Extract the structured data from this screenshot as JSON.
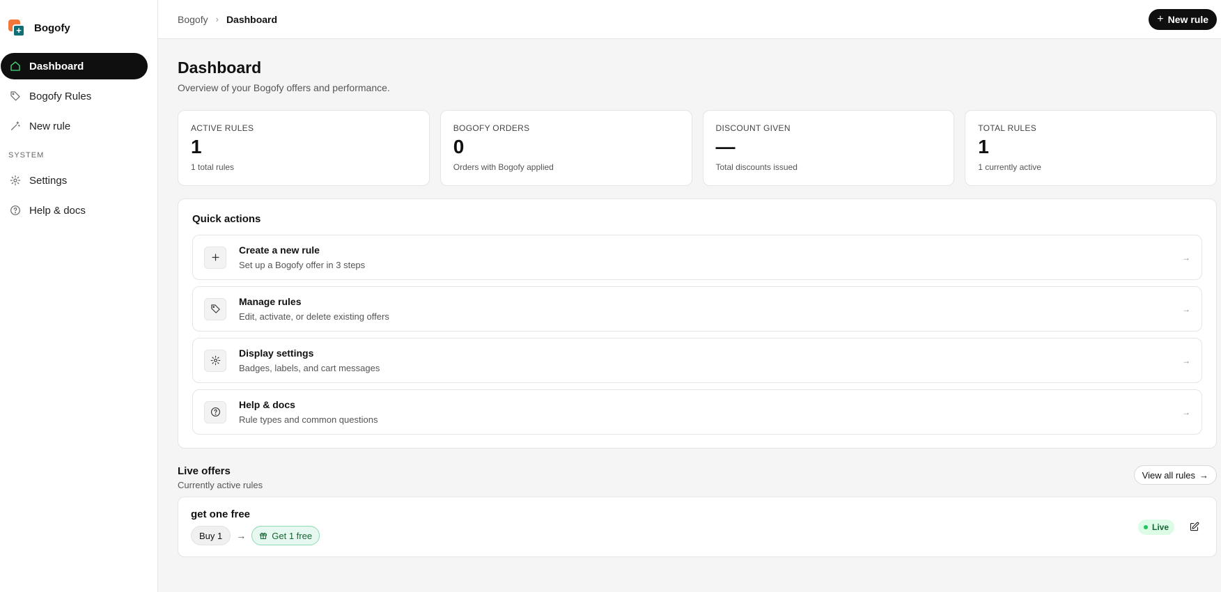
{
  "app": {
    "name": "Bogofy"
  },
  "sidebar": {
    "items": [
      {
        "label": "Dashboard",
        "icon": "home-icon"
      },
      {
        "label": "Bogofy Rules",
        "icon": "tag-icon"
      },
      {
        "label": "New rule",
        "icon": "wand-icon"
      }
    ],
    "section_label": "SYSTEM",
    "system_items": [
      {
        "label": "Settings",
        "icon": "gear-icon"
      },
      {
        "label": "Help & docs",
        "icon": "help-circle-icon"
      }
    ]
  },
  "header": {
    "breadcrumb": [
      "Bogofy",
      "Dashboard"
    ],
    "new_rule_label": "New rule"
  },
  "page": {
    "title": "Dashboard",
    "subtitle": "Overview of your Bogofy offers and performance."
  },
  "stats": [
    {
      "label": "ACTIVE RULES",
      "value": "1",
      "note": "1 total rules"
    },
    {
      "label": "BOGOFY ORDERS",
      "value": "0",
      "note": "Orders with Bogofy applied"
    },
    {
      "label": "DISCOUNT GIVEN",
      "value": "—",
      "note": "Total discounts issued"
    },
    {
      "label": "TOTAL RULES",
      "value": "1",
      "note": "1 currently active"
    }
  ],
  "quick_actions": {
    "title": "Quick actions",
    "items": [
      {
        "title": "Create a new rule",
        "desc": "Set up a Bogofy offer in 3 steps",
        "icon": "plus-icon"
      },
      {
        "title": "Manage rules",
        "desc": "Edit, activate, or delete existing offers",
        "icon": "tag-icon"
      },
      {
        "title": "Display settings",
        "desc": "Badges, labels, and cart messages",
        "icon": "gear-icon"
      },
      {
        "title": "Help & docs",
        "desc": "Rule types and common questions",
        "icon": "help-circle-icon"
      }
    ]
  },
  "live_offers": {
    "title": "Live offers",
    "subtitle": "Currently active rules",
    "view_all_label": "View all rules",
    "offers": [
      {
        "name": "get one free",
        "buy": "Buy 1",
        "get": "Get 1 free",
        "status": "Live"
      }
    ]
  },
  "colors": {
    "accent_dark": "#0f0f0f",
    "live_green": "#22c55e",
    "brand_orange": "#f2763a",
    "brand_teal": "#0f6e76"
  }
}
